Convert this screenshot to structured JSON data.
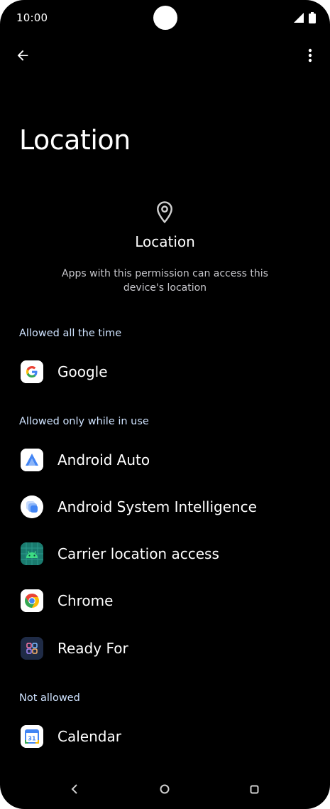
{
  "status_bar": {
    "time": "10:00"
  },
  "page": {
    "title": "Location"
  },
  "header": {
    "title": "Location",
    "description": "Apps with this permission can access this device's location"
  },
  "sections": {
    "always": {
      "label": "Allowed all the time",
      "apps": [
        {
          "name": "Google",
          "icon": "google-icon"
        }
      ]
    },
    "while_in_use": {
      "label": "Allowed only while in use",
      "apps": [
        {
          "name": "Android Auto",
          "icon": "android-auto-icon"
        },
        {
          "name": "Android System Intelligence",
          "icon": "android-system-intelligence-icon"
        },
        {
          "name": "Carrier location access",
          "icon": "android-robot-icon"
        },
        {
          "name": "Chrome",
          "icon": "chrome-icon"
        },
        {
          "name": "Ready For",
          "icon": "ready-for-icon"
        }
      ]
    },
    "not_allowed": {
      "label": "Not allowed",
      "apps": [
        {
          "name": "Calendar",
          "icon": "calendar-icon"
        }
      ]
    }
  },
  "calendar_icon_day": "31",
  "colors": {
    "background": "#000000",
    "section_label": "#cfe3ff",
    "secondary_text": "#c7c7cc"
  }
}
